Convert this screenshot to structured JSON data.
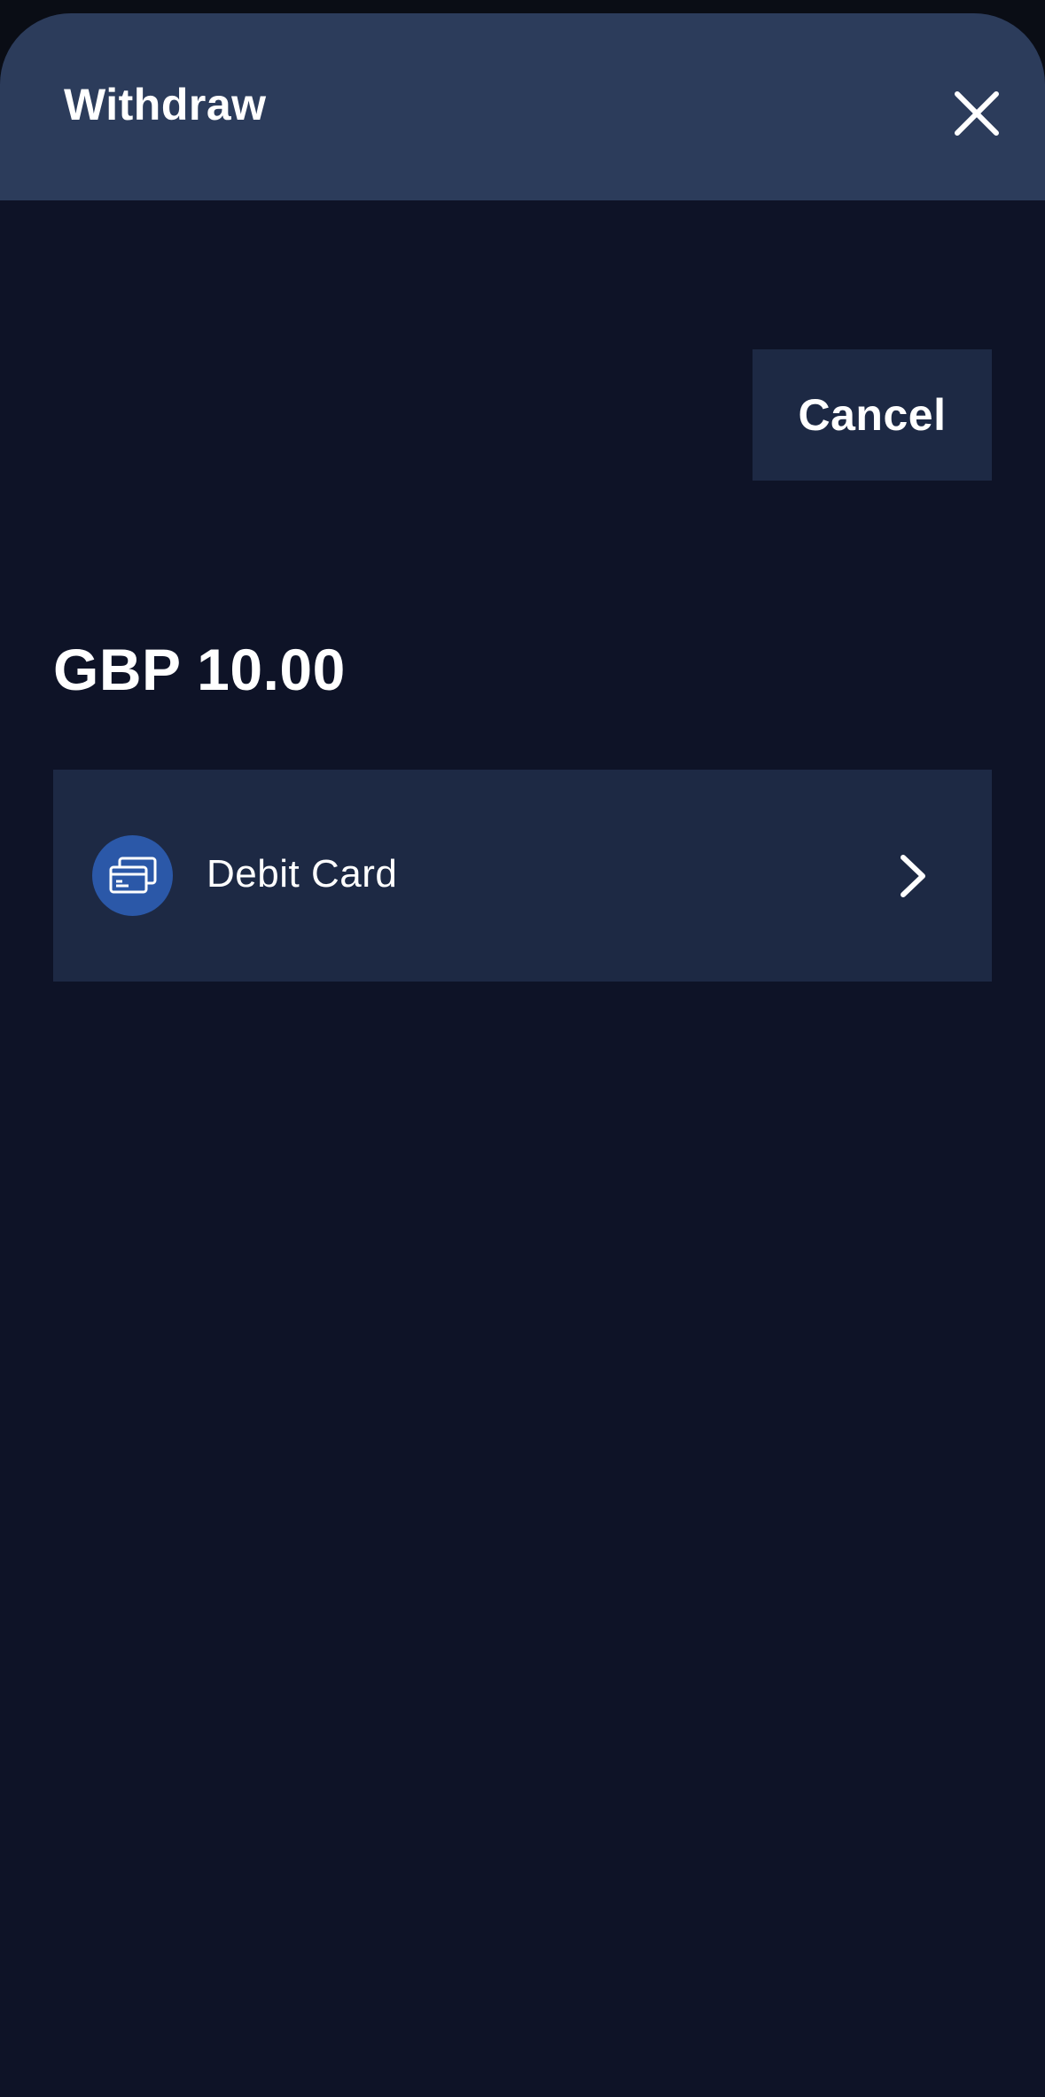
{
  "header": {
    "title": "Withdraw",
    "close_icon": "close-icon"
  },
  "actions": {
    "cancel_label": "Cancel"
  },
  "amount": {
    "text": "GBP 10.00"
  },
  "payment_methods": [
    {
      "label": "Debit Card",
      "icon": "credit-card-icon",
      "chevron_icon": "chevron-right-icon"
    }
  ],
  "colors": {
    "background": "#0e1327",
    "header": "#2c3c5b",
    "card": "#1d2944",
    "icon_circle": "#2b58a8",
    "text": "#ffffff"
  }
}
